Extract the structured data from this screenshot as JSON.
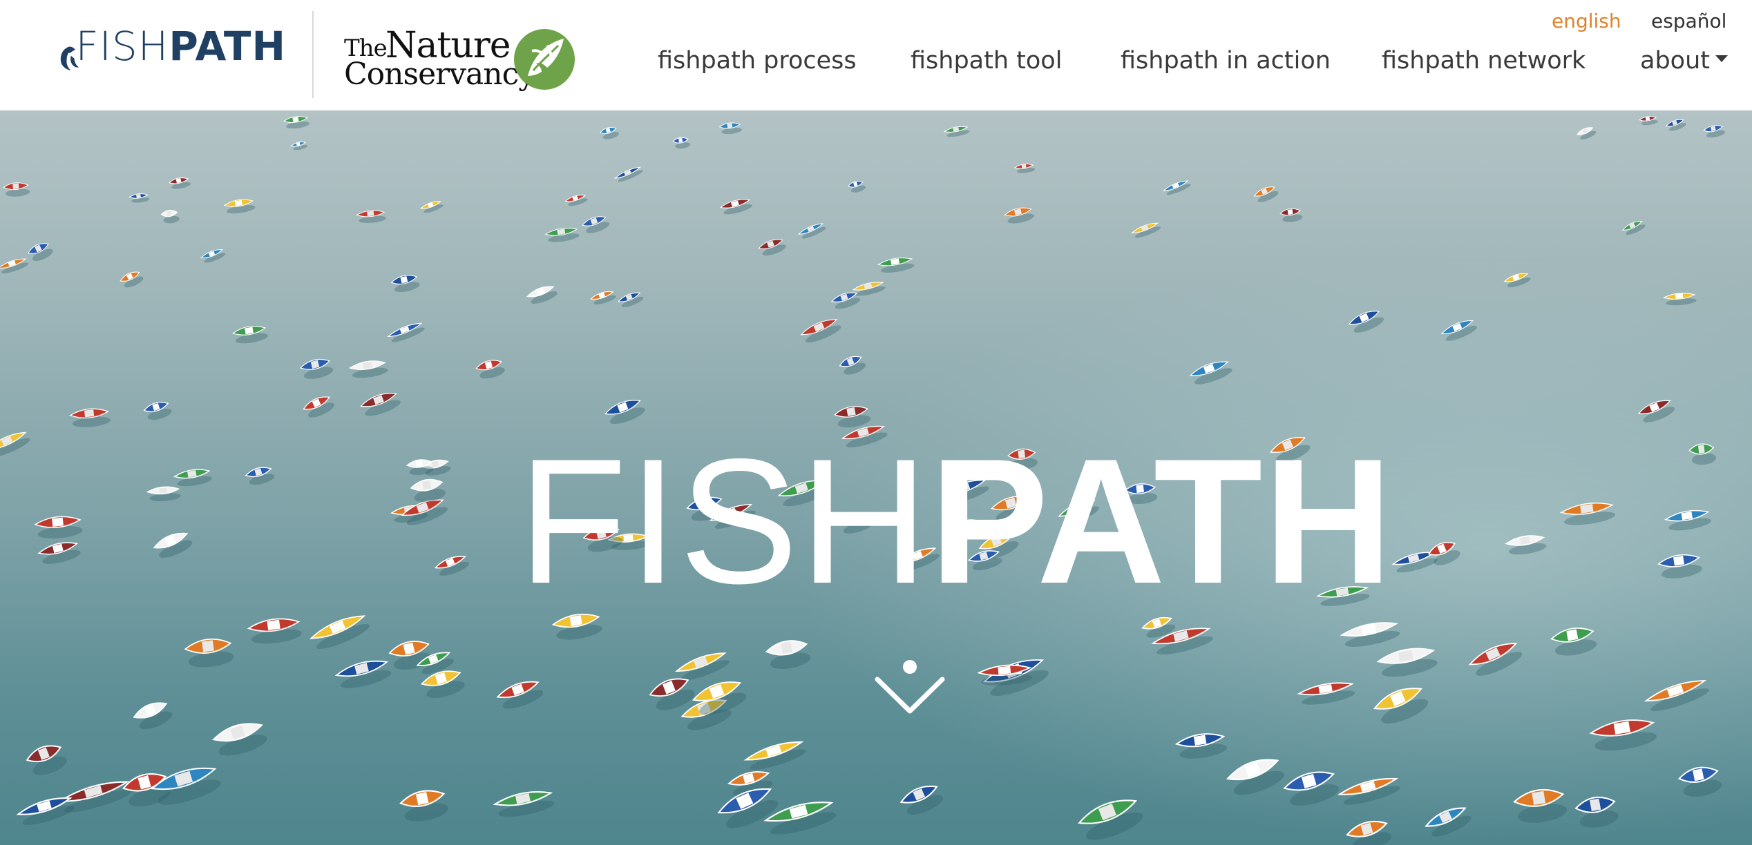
{
  "brand": {
    "logo_part1": "FISH",
    "logo_part2": "PATH",
    "partner_the": "The",
    "partner_nature": "Nature",
    "partner_conservancy": "Conservancy"
  },
  "languages": {
    "english": "english",
    "spanish": "español",
    "active": "english"
  },
  "nav": {
    "process": "fishpath process",
    "tool": "fishpath tool",
    "in_action": "fishpath in action",
    "network": "fishpath network",
    "about": "about"
  },
  "hero": {
    "title_part1": "FISH",
    "title_part2": "PATH",
    "scroll_icon": "chevron-down-icon"
  },
  "colors": {
    "brand_navy": "#1f3f63",
    "accent_orange": "#e0822a",
    "tnc_green": "#6fa34a",
    "nav_text": "#3a3a3a"
  }
}
